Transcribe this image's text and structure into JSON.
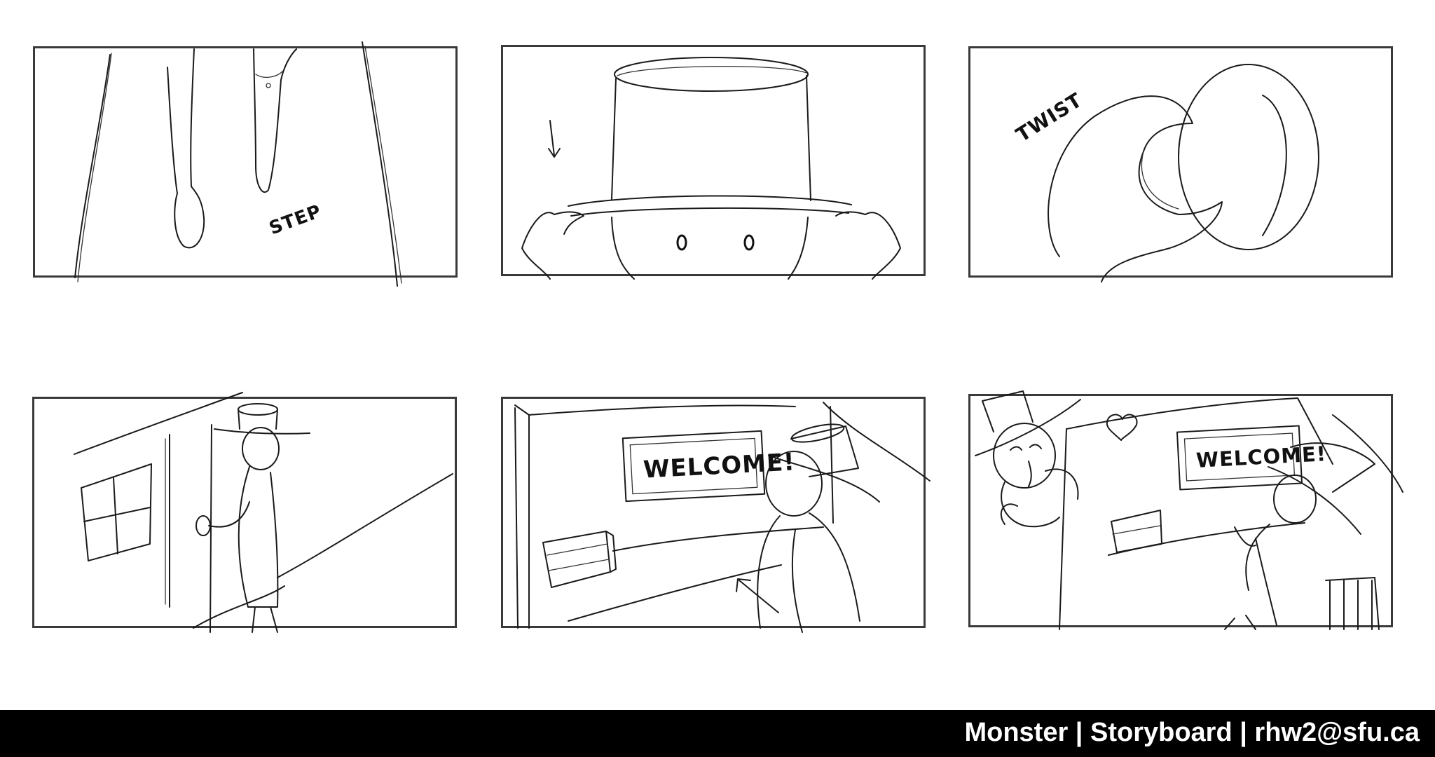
{
  "panels": [
    {
      "id": "p1",
      "sfx": "STEP"
    },
    {
      "id": "p2",
      "sfx": ""
    },
    {
      "id": "p3",
      "sfx": "TWIST"
    },
    {
      "id": "p4",
      "sfx": ""
    },
    {
      "id": "p5",
      "sign": "WELCOME!"
    },
    {
      "id": "p6",
      "sign": "WELCOME!"
    }
  ],
  "footer": {
    "text": "Monster | Storyboard | rhw2@sfu.ca"
  },
  "colors": {
    "background": "#ffffff",
    "line": "#1a1a1a",
    "footer_bg": "#000000",
    "footer_text": "#ffffff"
  }
}
